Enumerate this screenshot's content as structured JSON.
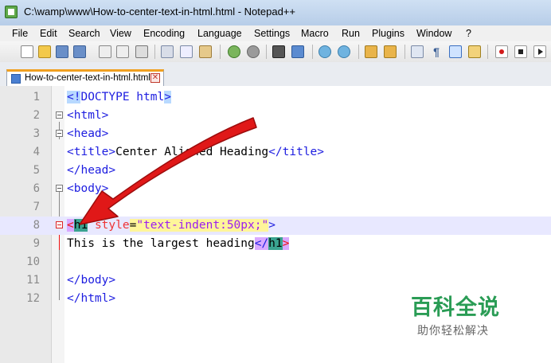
{
  "window": {
    "title": "C:\\wamp\\www\\How-to-center-text-in-html.html - Notepad++"
  },
  "menu": {
    "items": [
      "File",
      "Edit",
      "Search",
      "View",
      "Encoding",
      "Language",
      "Settings",
      "Macro",
      "Run",
      "Plugins",
      "Window",
      "?"
    ]
  },
  "toolbar": {
    "icons": [
      "new-file-icon",
      "open-file-icon",
      "save-icon",
      "save-all-icon",
      "close-icon",
      "close-all-icon",
      "print-icon",
      "cut-icon",
      "copy-icon",
      "paste-icon",
      "undo-icon",
      "redo-icon",
      "find-icon",
      "replace-icon",
      "zoom-in-icon",
      "zoom-out-icon",
      "sync-v-icon",
      "sync-h-icon",
      "word-wrap-icon",
      "show-all-chars-icon",
      "indent-guide-icon",
      "udl-icon",
      "record-macro-icon",
      "stop-macro-icon",
      "play-macro-icon"
    ]
  },
  "tab": {
    "label": "How-to-center-text-in-html.html",
    "close": "✕"
  },
  "editor": {
    "line_numbers": [
      "1",
      "2",
      "3",
      "4",
      "5",
      "6",
      "7",
      "8",
      "9",
      "10",
      "11",
      "12"
    ],
    "lines": {
      "l1": {
        "open": "<!",
        "kw": "DOCTYPE html",
        "close": ">"
      },
      "l2": "<html>",
      "l3": "<head>",
      "l4": {
        "open": "<title>",
        "text": "Center Aligned Heading",
        "close": "</title>"
      },
      "l5": "</head>",
      "l6": "<body>",
      "l8": {
        "lt": "<",
        "tag": "h1",
        "attr": "style",
        "eq": "=",
        "value": "\"text-indent:50px;\"",
        "gt": ">"
      },
      "l9": {
        "text": "This is the largest heading",
        "close_open": "</",
        "close_tag": "h1",
        "close_end": ">"
      },
      "l11": "</body>",
      "l12": "</html>"
    }
  },
  "watermark": {
    "title": "百科全说",
    "subtitle": "助你轻松解决"
  },
  "colors": {
    "tag": "#1d1de0",
    "attribute": "#e33",
    "attribute_value": "#9b1ef0",
    "arrow": "#e01818",
    "watermark": "#2a9c55"
  }
}
